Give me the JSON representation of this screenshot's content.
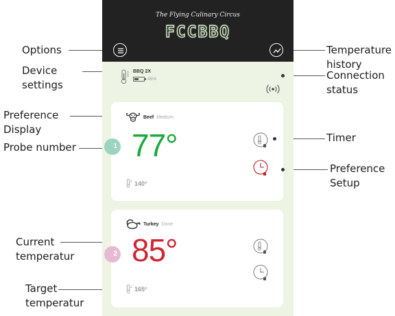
{
  "brand": {
    "tagline": "The Flying Culinary Circus",
    "name": "FCCBBQ"
  },
  "header": {
    "options_icon": "menu-circle-icon",
    "history_icon": "trend-chart-icon"
  },
  "device": {
    "name": "BBQ 2X",
    "battery_pct": "45%",
    "battery_level": 0.45,
    "connection_icon": "wireless-signal-icon"
  },
  "probes": [
    {
      "number": "1",
      "meat": "Beef",
      "doneness": "Medium",
      "current_temp": "77°",
      "target_temp": "140°",
      "color": "#1aab3c",
      "badge_color": "#9dd4bf"
    },
    {
      "number": "2",
      "meat": "Turkey",
      "doneness": "Done",
      "current_temp": "85°",
      "target_temp": "165°",
      "color": "#cf2734",
      "badge_color": "#e7bad3"
    }
  ],
  "annotations": {
    "options": "Options",
    "device_settings_1": "Device",
    "device_settings_2": "settings",
    "preference_display_1": "Preference",
    "preference_display_2": "Display",
    "probe_number": "Probe number",
    "current_temp_1": "Current",
    "current_temp_2": "temperatur",
    "target_temp_1": "Target",
    "target_temp_2": "temperatur",
    "temp_history_1": "Temperature",
    "temp_history_2": "history",
    "connection_1": "Connection",
    "connection_2": "status",
    "timer": "Timer",
    "pref_setup_1": "Preference",
    "pref_setup_2": "Setup"
  },
  "colors": {
    "header_bg": "#222222",
    "app_bg": "#eef4e4",
    "alert_red": "#c0392b"
  }
}
